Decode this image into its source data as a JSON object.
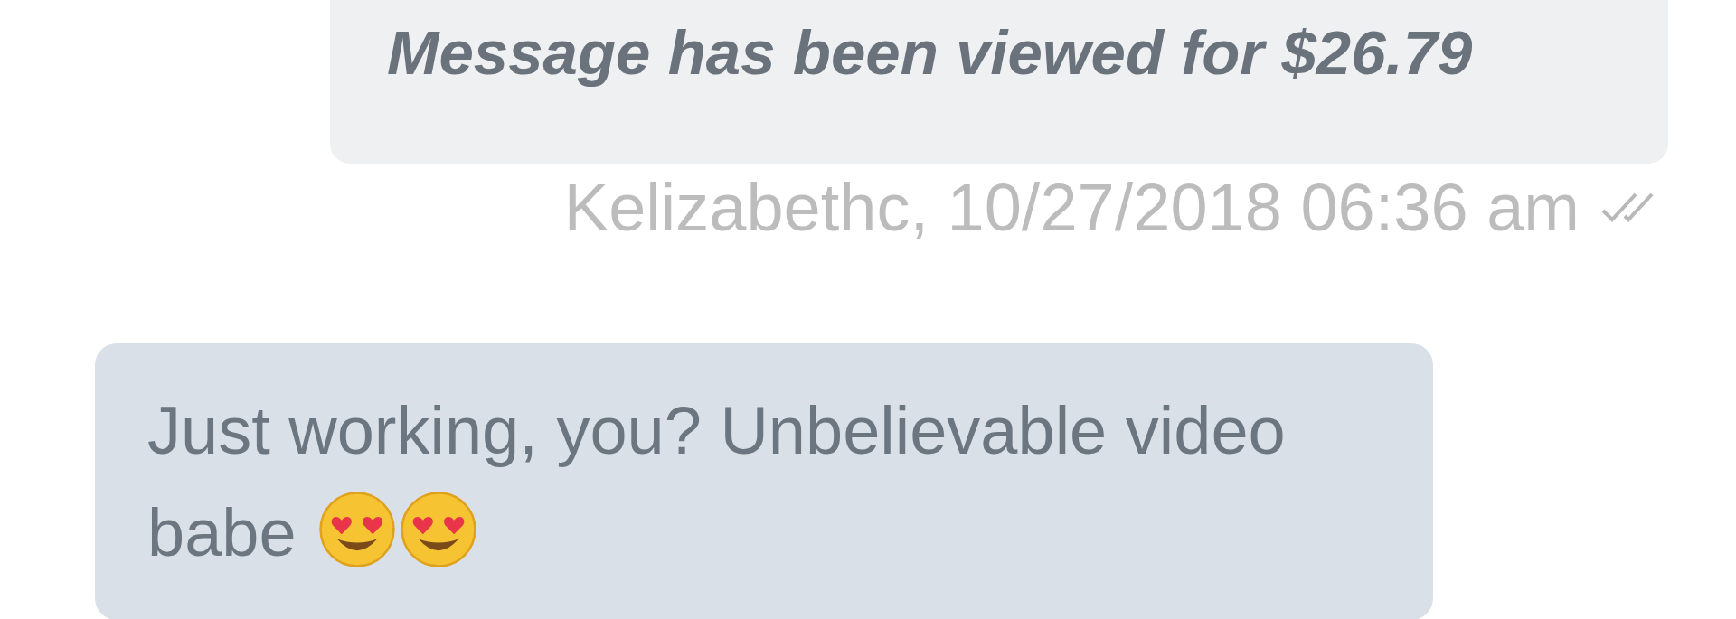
{
  "messages": [
    {
      "kind": "outgoing",
      "text": "Message has been viewed for $26.79",
      "caption": "Kelizabethc, 10/27/2018 06:36 am",
      "read": true
    },
    {
      "kind": "incoming",
      "text": "Just working, you? Unbelievable video babe",
      "emojis": [
        {
          "kind": "heart_eyes"
        },
        {
          "kind": "heart_eyes"
        }
      ]
    }
  ]
}
